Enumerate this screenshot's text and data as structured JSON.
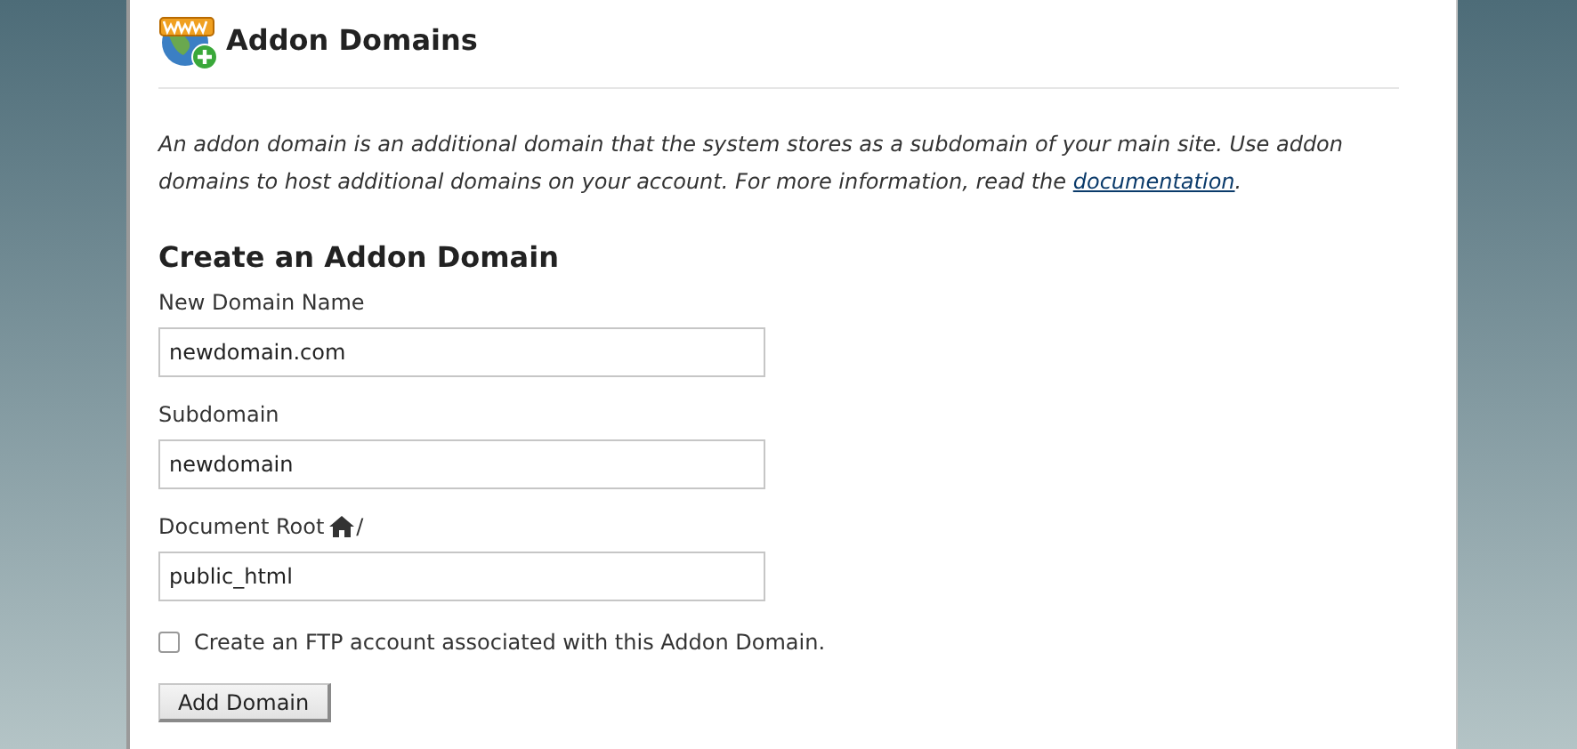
{
  "page": {
    "title": "Addon Domains"
  },
  "intro": {
    "text": "An addon domain is an additional domain that the system stores as a subdomain of your main site. Use addon domains to host additional domains on your account. For more information, read the ",
    "link": "documentation",
    "end": "."
  },
  "form": {
    "heading": "Create an Addon Domain",
    "fields": [
      {
        "label": "New Domain Name",
        "value": "newdomain.com",
        "home_icon": false
      },
      {
        "label": "Subdomain",
        "value": "newdomain",
        "home_icon": false
      },
      {
        "label": "Document Root",
        "suffix": "/",
        "value": "public_html",
        "home_icon": true
      }
    ],
    "ftp_option": {
      "label": "Create an FTP account associated with this Addon Domain.",
      "checked": false
    },
    "submit": "Add Domain"
  }
}
